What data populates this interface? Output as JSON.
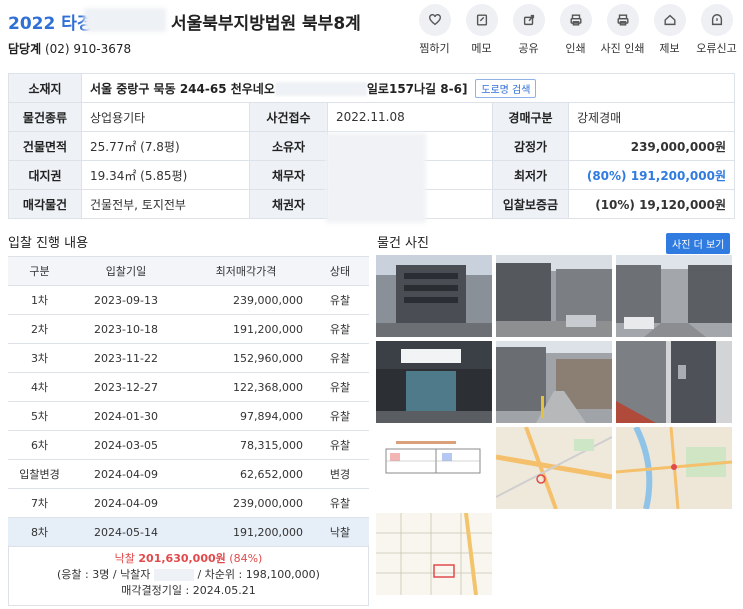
{
  "header": {
    "case_no": "2022 타경",
    "court": "서울북부지방법원 북부8계",
    "contact_label": "담당계",
    "contact_phone": "(02) 910-3678"
  },
  "toolbar": [
    {
      "label": "찜하기",
      "icon": "heart-icon"
    },
    {
      "label": "메모",
      "icon": "memo-icon"
    },
    {
      "label": "공유",
      "icon": "share-icon"
    },
    {
      "label": "인쇄",
      "icon": "print-icon"
    },
    {
      "label": "사진 인쇄",
      "icon": "photo-print-icon"
    },
    {
      "label": "제보",
      "icon": "home-icon"
    },
    {
      "label": "오류신고",
      "icon": "alert-icon"
    }
  ],
  "info": {
    "location_label": "소재지",
    "location_value_a": "서울 중랑구 묵동 244-65 천우네오",
    "location_value_b": "일로157나길 8-6]",
    "road_button": "도로명 검색",
    "type_label": "물건종류",
    "type_value": "상업용기타",
    "received_label": "사건접수",
    "received_value": "2022.11.08",
    "auction_kind_label": "경매구분",
    "auction_kind_value": "강제경매",
    "area_label": "건물면적",
    "area_value": "25.77㎡ (7.8평)",
    "owner_label": "소유자",
    "appraisal_label": "감정가",
    "appraisal_value": "239,000,000원",
    "land_label": "대지권",
    "land_value": "19.34㎡ (5.85평)",
    "debtor_label": "채무자",
    "min_label": "최저가",
    "min_value": "(80%) 191,200,000원",
    "sale_label": "매각물건",
    "sale_value": "건물전부, 토지전부",
    "creditor_label": "채권자",
    "deposit_label": "입찰보증금",
    "deposit_value": "(10%) 19,120,000원"
  },
  "bidding": {
    "title": "입찰 진행 내용",
    "headers": [
      "구분",
      "입찰기일",
      "최저매각가격",
      "상태"
    ],
    "rows": [
      {
        "round": "1차",
        "date": "2023-09-13",
        "price": "239,000,000",
        "status": "유찰"
      },
      {
        "round": "2차",
        "date": "2023-10-18",
        "price": "191,200,000",
        "status": "유찰"
      },
      {
        "round": "3차",
        "date": "2023-11-22",
        "price": "152,960,000",
        "status": "유찰"
      },
      {
        "round": "4차",
        "date": "2023-12-27",
        "price": "122,368,000",
        "status": "유찰"
      },
      {
        "round": "5차",
        "date": "2024-01-30",
        "price": "97,894,000",
        "status": "유찰"
      },
      {
        "round": "6차",
        "date": "2024-03-05",
        "price": "78,315,000",
        "status": "유찰"
      },
      {
        "round": "입찰변경",
        "date": "2024-04-09",
        "price": "62,652,000",
        "status": "변경"
      },
      {
        "round": "7차",
        "date": "2024-04-09",
        "price": "239,000,000",
        "status": "유찰"
      },
      {
        "round": "8차",
        "date": "2024-05-14",
        "price": "191,200,000",
        "status": "낙찰"
      }
    ],
    "summary": {
      "winning_label": "낙찰",
      "winning_value": "201,630,000원",
      "winning_pct": "(84%)",
      "line2_a": "(응찰 : 3명 / 낙찰자",
      "line2_b": "/ 차순위 : 198,100,000)",
      "line3": "매각결정기일 : 2024.05.21"
    }
  },
  "photos": {
    "title": "물건 사진",
    "more_button": "사진 더 보기",
    "items": [
      "building-exterior",
      "street-view",
      "alley-view",
      "entrance-sign",
      "side-street",
      "stairwell-door",
      "floor-plan",
      "map-1",
      "map-2",
      "cadastral-map"
    ]
  }
}
